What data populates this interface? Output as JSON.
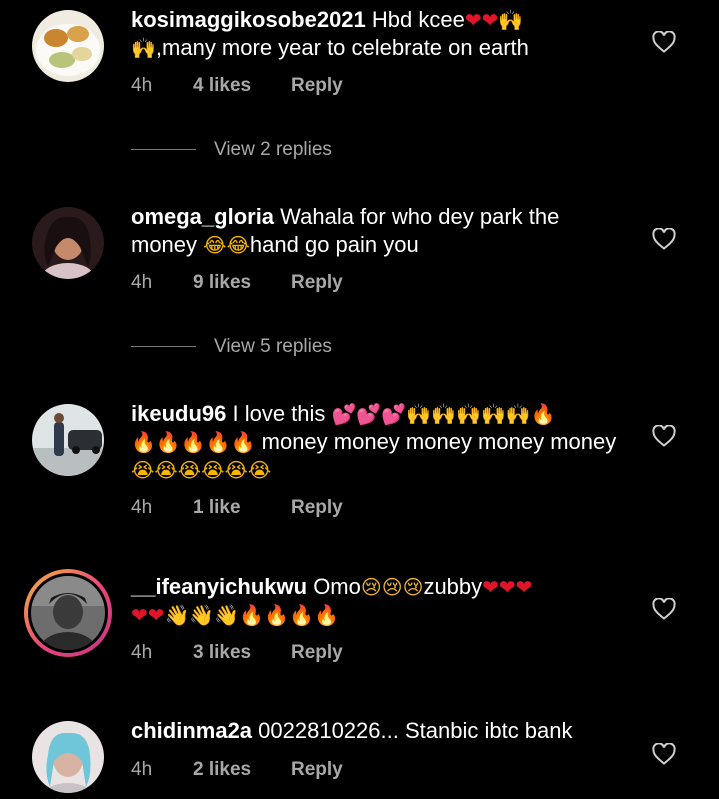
{
  "comments": [
    {
      "username": "kosimaggikosobe2021",
      "text_a": " Hbd  kcee",
      "emoji_a": "❤❤",
      "emoji_b": "🙌",
      "emoji_c": "🙌",
      "text_b": ",many more year to celebrate  on earth",
      "time": "4h",
      "likes": "4 likes",
      "reply": "Reply",
      "view_replies": "View 2 replies"
    },
    {
      "username": "omega_gloria",
      "text_a": " Wahala for who dey park the money ",
      "emoji_a": "😂😂",
      "text_b": "hand go pain you",
      "time": "4h",
      "likes": "9 likes",
      "reply": "Reply",
      "view_replies": "View 5 replies"
    },
    {
      "username": "ikeudu96",
      "text_a": " I love this ",
      "emoji_hearts": "💕💕💕",
      "emoji_hands": "🙌🙌🙌🙌🙌",
      "emoji_fire1": "🔥",
      "emoji_fire2": "🔥🔥🔥🔥🔥",
      "text_b": " money money money money money ",
      "emoji_cry": "😭😭😭😭😭😭",
      "time": "4h",
      "likes": "1 like",
      "reply": "Reply"
    },
    {
      "username": "__ifeanyichukwu",
      "text_a": " Omo",
      "emoji_sad": "😢😢😢",
      "text_b": "zubby",
      "emoji_hearts1": "❤❤❤",
      "emoji_hearts2": "❤❤",
      "emoji_wave": "👋👋👋",
      "emoji_fire": "🔥🔥🔥🔥",
      "time": "4h",
      "likes": "3 likes",
      "reply": "Reply"
    },
    {
      "username": "chidinma2a",
      "text_a": " 0022810226... Stanbic ibtc bank",
      "time": "4h",
      "likes": "2 likes",
      "reply": "Reply"
    }
  ],
  "icons": {
    "like": "heart-outline-icon"
  },
  "colors": {
    "background": "#000000",
    "text": "#ffffff",
    "secondary_text": "#a8a8a8",
    "story_ring_start": "#f6b73c",
    "story_ring_end": "#c13584"
  }
}
